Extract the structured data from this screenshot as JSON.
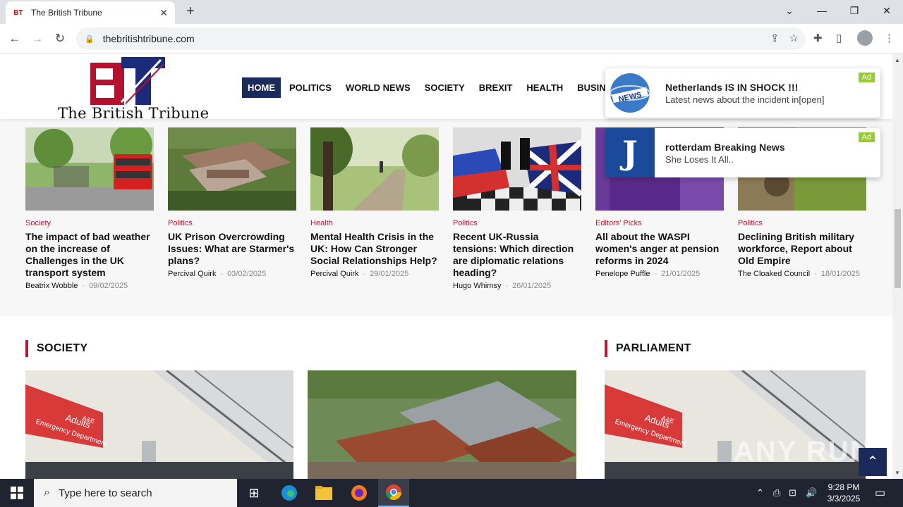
{
  "browser": {
    "tab_title": "The British Tribune",
    "tab_favicon": "BT",
    "url": "thebritishtribune.com"
  },
  "site": {
    "logo_letters": "BT",
    "logo_text": "The British Tribune",
    "nav": [
      "HOME",
      "POLITICS",
      "WORLD NEWS",
      "SOCIETY",
      "BREXIT",
      "HEALTH",
      "BUSINESS"
    ],
    "active_nav": "HOME"
  },
  "articles": [
    {
      "category": "Society",
      "title": "The impact of bad weather on the increase of Challenges in the UK transport system",
      "author": "Beatrix Wobble",
      "date": "09/02/2025"
    },
    {
      "category": "Politics",
      "title": "UK Prison Overcrowding Issues: What are Starmer's plans?",
      "author": "Percival Quirk",
      "date": "03/02/2025"
    },
    {
      "category": "Health",
      "title": "Mental Health Crisis in the UK: How Can Stronger Social Relationships Help?",
      "author": "Percival Quirk",
      "date": "29/01/2025"
    },
    {
      "category": "Politics",
      "title": "Recent UK-Russia tensions: Which direction are diplomatic relations heading?",
      "author": "Hugo Whimsy",
      "date": "26/01/2025"
    },
    {
      "category": "Editors' Picks",
      "title": "All about the WASPI women's anger at pension reforms in 2024",
      "author": "Penelope Puffle",
      "date": "21/01/2025"
    },
    {
      "category": "Politics",
      "title": "Declining British military workforce, Report about Old Empire",
      "author": "The Cloaked Council",
      "date": "18/01/2025"
    }
  ],
  "sections": {
    "society": "SOCIETY",
    "parliament": "PARLIAMENT"
  },
  "image_signs": {
    "er_sign_line1": "Adults",
    "er_sign_line2": "Emergency Department",
    "er_sign_badge": "A&E"
  },
  "ads": [
    {
      "title": "Netherlands IS IN SHOCK !!!",
      "subtitle": "Latest news about the incident in[open]",
      "badge": "Ad",
      "image_text": "NEWS"
    },
    {
      "title": "rotterdam Breaking News",
      "subtitle": "She Loses It All..",
      "badge": "Ad",
      "image_text": "J"
    }
  ],
  "watermark": "ANY RUN",
  "taskbar": {
    "search_placeholder": "Type here to search",
    "time": "9:28 PM",
    "date": "3/3/2025"
  }
}
